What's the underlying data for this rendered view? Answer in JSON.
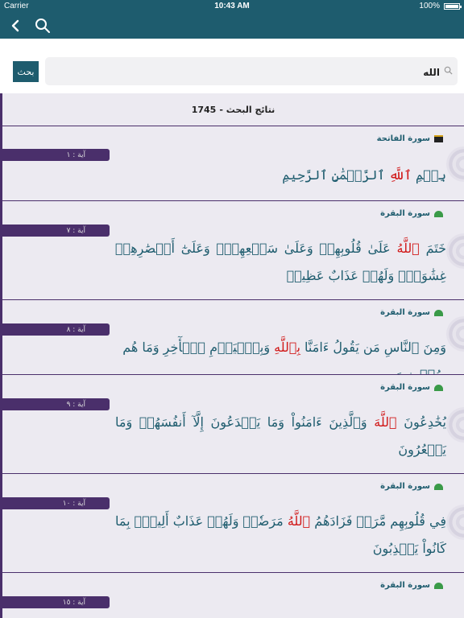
{
  "status_bar": {
    "carrier": "Carrier",
    "time": "10:43 AM",
    "battery": "100%"
  },
  "nav": {
    "back_icon": "chevron-left-icon",
    "search_icon": "search-icon"
  },
  "search": {
    "button_label": "بحث",
    "query": "الله"
  },
  "results_header": {
    "title": "نتائج البحث -",
    "count": "1745"
  },
  "results": [
    {
      "surah": "سورة الفاتحة",
      "surah_icon": "kaaba-icon",
      "ayah": "آية : ١",
      "verse": [
        {
          "t": "بِسۡمِ "
        },
        {
          "t": "ٱللَّهِ",
          "hl": true
        },
        {
          "t": " ٱلرَّحۡمَٰنِ ٱلرَّحِيمِ"
        }
      ]
    },
    {
      "surah": "سورة البقرة",
      "surah_icon": "mosque-icon",
      "ayah": "آية : ٧",
      "verse": [
        {
          "t": "خَتَمَ "
        },
        {
          "t": "ٱللَّهُ",
          "hl": true
        },
        {
          "t": " عَلَىٰ قُلُوبِهِمۡ وَعَلَىٰ سَمۡعِهِمۡۖ وَعَلَىٰٓ أَبۡصَٰرِهِمۡ غِشَٰوَةٞۖ وَلَهُمۡ عَذَابٌ عَظِيمٞ"
        }
      ]
    },
    {
      "surah": "سورة البقرة",
      "surah_icon": "mosque-icon",
      "ayah": "آية : ٨",
      "verse": [
        {
          "t": "وَمِنَ ٱلنَّاسِ مَن يَقُولُ ءَامَنَّا "
        },
        {
          "t": "بِٱللَّهِ",
          "hl": true
        },
        {
          "t": " وَبِٱلۡيَوۡمِ ٱلۡأٓخِرِ وَمَا هُم بِمُؤۡمِنِينَ"
        }
      ]
    },
    {
      "surah": "سورة البقرة",
      "surah_icon": "mosque-icon",
      "ayah": "آية : ٩",
      "verse": [
        {
          "t": "يُخَٰدِعُونَ "
        },
        {
          "t": "ٱللَّهَ",
          "hl": true
        },
        {
          "t": " وَٱلَّذِينَ ءَامَنُواْ وَمَا يَخۡدَعُونَ إِلَّآ أَنفُسَهُمۡ وَمَا يَشۡعُرُونَ"
        }
      ]
    },
    {
      "surah": "سورة البقرة",
      "surah_icon": "mosque-icon",
      "ayah": "آية : ١٠",
      "verse": [
        {
          "t": "فِي قُلُوبِهِم مَّرَضٞ فَزَادَهُمُ "
        },
        {
          "t": "ٱللَّهُ",
          "hl": true
        },
        {
          "t": " مَرَضٗاۖ وَلَهُمۡ عَذَابٌ أَلِيمُۢ بِمَا كَانُواْ يَكۡذِبُونَ"
        }
      ]
    },
    {
      "surah": "سورة البقرة",
      "surah_icon": "mosque-icon",
      "ayah": "آية : ١٥",
      "verse": []
    }
  ],
  "colors": {
    "primary": "#1e5c6e",
    "highlight": "#d11818",
    "ayah_badge": "#4a2f6b",
    "list_bg": "#eceaf1"
  }
}
